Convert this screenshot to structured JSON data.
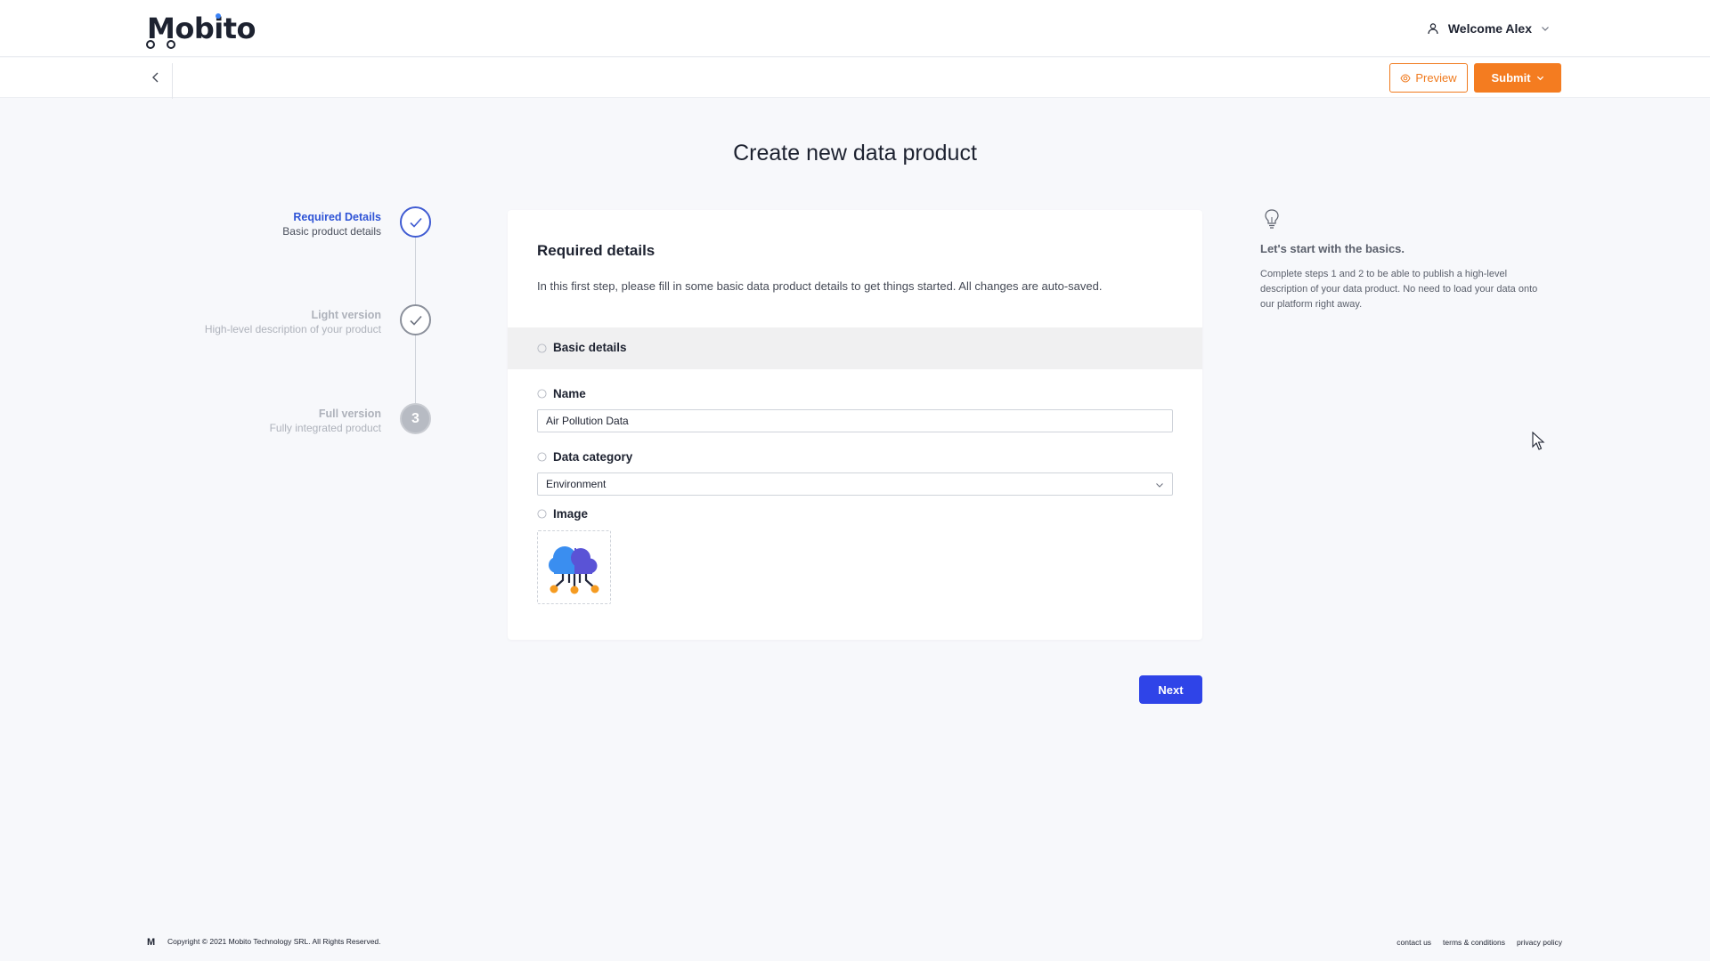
{
  "header": {
    "logo_text": "Mobito",
    "welcome": "Welcome Alex"
  },
  "actions": {
    "preview_label": "Preview",
    "submit_label": "Submit"
  },
  "page": {
    "title": "Create new data product"
  },
  "stepper": {
    "steps": [
      {
        "title": "Required Details",
        "subtitle": "Basic product details",
        "state": "active"
      },
      {
        "title": "Light version",
        "subtitle": "High-level description of your product",
        "state": "completed"
      },
      {
        "title": "Full version",
        "subtitle": "Fully integrated product",
        "number": "3",
        "state": "pending"
      }
    ]
  },
  "form": {
    "title": "Required details",
    "description": "In this first step, please fill in some basic data product details to get things started. All changes are auto-saved.",
    "section_label": "Basic details",
    "name_label": "Name",
    "name_value": "Air Pollution Data",
    "category_label": "Data category",
    "category_value": "Environment",
    "image_label": "Image"
  },
  "next_label": "Next",
  "tip": {
    "title": "Let's start with the basics.",
    "body": "Complete steps 1 and 2 to be able to publish a high-level description of your data product. No need to load your data onto our platform right away."
  },
  "footer": {
    "logo_mark": "M",
    "copyright": "Copyright © 2021 Mobito Technology SRL. All Rights Reserved.",
    "links": [
      "contact us",
      "terms & conditions",
      "privacy policy"
    ]
  },
  "colors": {
    "accent_orange": "#f47c20",
    "primary_blue": "#2f44e8",
    "step_active": "#2f54d6"
  },
  "icons": [
    "user-icon",
    "chevron-down-icon",
    "back-arrow-icon",
    "eye-icon",
    "check-icon",
    "info-icon",
    "lightbulb-icon",
    "cloud-network-icon",
    "mouse-cursor-icon"
  ]
}
